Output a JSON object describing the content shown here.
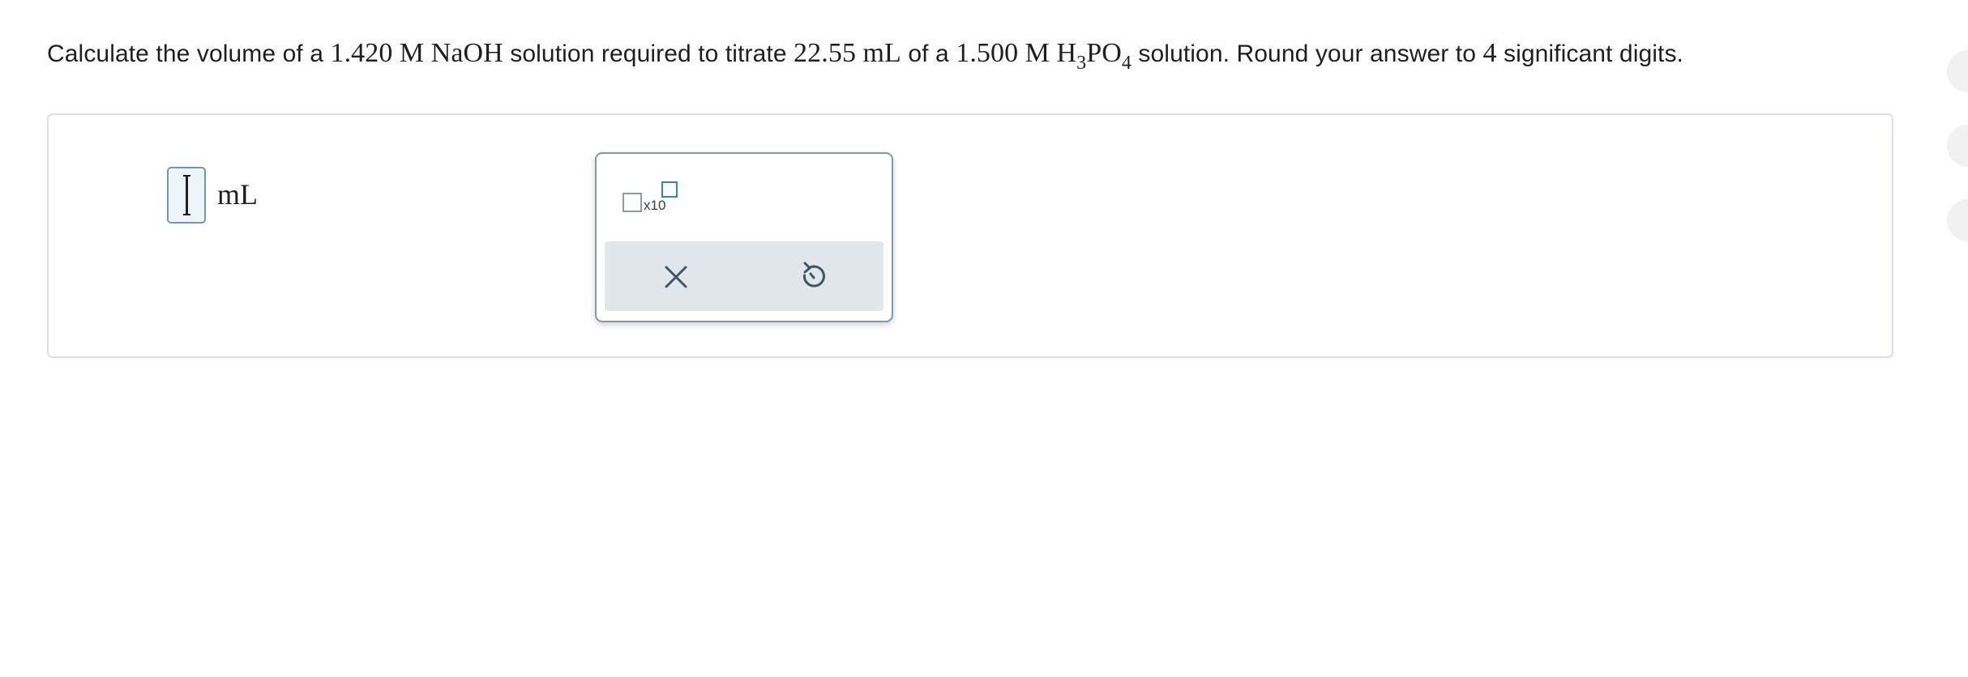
{
  "question": {
    "t1": "Calculate the volume of a ",
    "m1": "1.420",
    "m2": "M",
    "m3": "NaOH",
    "t2": " solution required to titrate ",
    "m4": "22.55",
    "m5": "mL",
    "t3": " of a ",
    "m6": "1.500",
    "m7": "M",
    "m8_a": "H",
    "m8_sub1": "3",
    "m8_b": "PO",
    "m8_sub2": "4",
    "t4": " solution. Round your answer to ",
    "m9": "4",
    "t5": " significant digits."
  },
  "answer": {
    "value": "",
    "unit": "mL"
  },
  "toolbox": {
    "sci_notation_label": "x10",
    "clear_icon": "close-icon",
    "undo_icon": "undo-icon"
  },
  "colors": {
    "input_border": "#6f97b3",
    "input_bg": "#eef5fa",
    "toolbox_border": "#7e9aac",
    "action_bar_bg": "#e1e6ea",
    "icon_color": "#3f5563",
    "exp_box_border": "#2e8bb8"
  }
}
